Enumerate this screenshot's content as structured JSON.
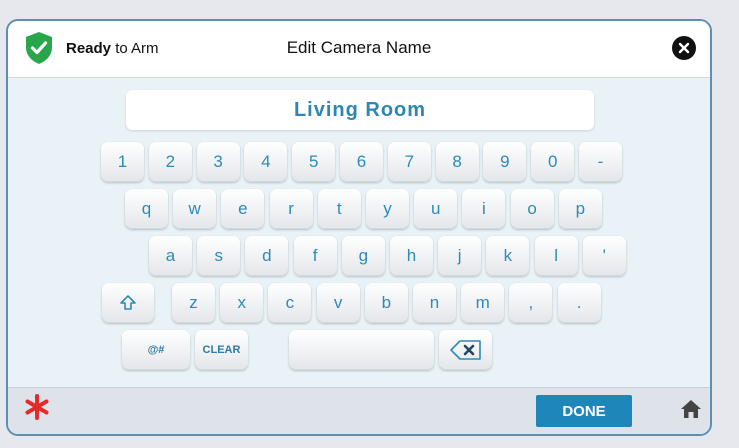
{
  "header": {
    "status_strong": "Ready",
    "status_rest": " to Arm",
    "title": "Edit Camera Name"
  },
  "name_field": {
    "value": "Living Room"
  },
  "keyboard": {
    "row1": [
      "1",
      "2",
      "3",
      "4",
      "5",
      "6",
      "7",
      "8",
      "9",
      "0",
      "-"
    ],
    "row2": [
      "q",
      "w",
      "e",
      "r",
      "t",
      "y",
      "u",
      "i",
      "o",
      "p"
    ],
    "row3": [
      "a",
      "s",
      "d",
      "f",
      "g",
      "h",
      "j",
      "k",
      "l",
      "'"
    ],
    "row4": [
      "z",
      "x",
      "c",
      "v",
      "b",
      "n",
      "m",
      ",",
      "."
    ],
    "symbols_label": "@#",
    "clear_label": "CLEAR"
  },
  "footer": {
    "done_label": "DONE"
  },
  "colors": {
    "accent": "#1f86b9",
    "key_text": "#2e8ab8",
    "shield_green": "#2aa64a",
    "alert_red": "#e32b2b"
  },
  "icons": [
    "shield-check-icon",
    "close-icon",
    "shift-icon",
    "backspace-icon",
    "asterisk-icon",
    "home-icon"
  ]
}
